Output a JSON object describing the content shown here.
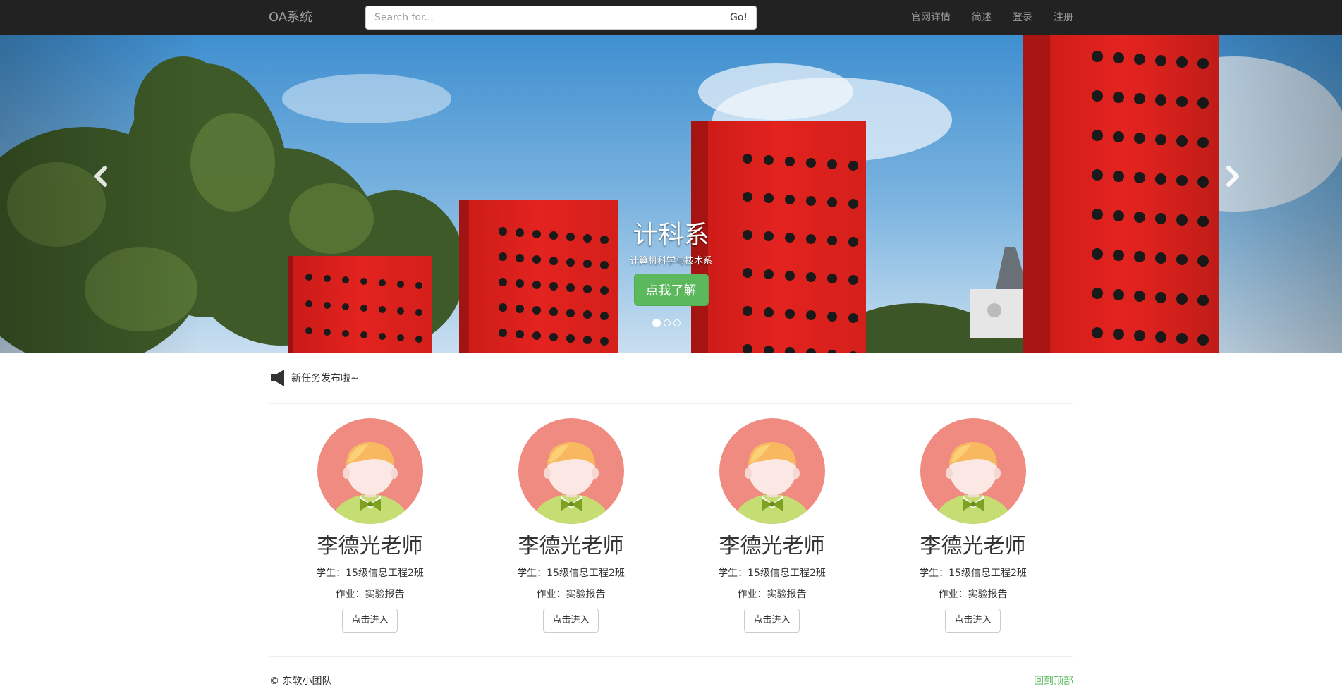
{
  "navbar": {
    "brand": "OA系统",
    "search_placeholder": "Search for...",
    "search_button": "Go!",
    "links": [
      "官网详情",
      "简述",
      "登录",
      "注册"
    ]
  },
  "carousel": {
    "title": "计科系",
    "subtitle": "计算机科学与技术系",
    "button": "点我了解",
    "indicator_count": 3,
    "active_indicator": 0,
    "prev_icon": "chevron-left-icon",
    "next_icon": "chevron-right-icon"
  },
  "announcement": {
    "icon": "megaphone-icon",
    "text": "新任务发布啦~"
  },
  "cards": [
    {
      "name": "李德光老师",
      "student": "学生：15级信息工程2班",
      "homework": "作业：实验报告",
      "button": "点击进入"
    },
    {
      "name": "李德光老师",
      "student": "学生：15级信息工程2班",
      "homework": "作业：实验报告",
      "button": "点击进入"
    },
    {
      "name": "李德光老师",
      "student": "学生：15级信息工程2班",
      "homework": "作业：实验报告",
      "button": "点击进入"
    },
    {
      "name": "李德光老师",
      "student": "学生：15级信息工程2班",
      "homework": "作业：实验报告",
      "button": "点击进入"
    }
  ],
  "footer": {
    "copyright": "© 东软小团队",
    "back_to_top": "回到顶部"
  },
  "colors": {
    "navbar_bg": "#222222",
    "primary_green": "#5cb85c",
    "red_wall": "#d9211e",
    "avatar_bg": "#ef8b80"
  }
}
